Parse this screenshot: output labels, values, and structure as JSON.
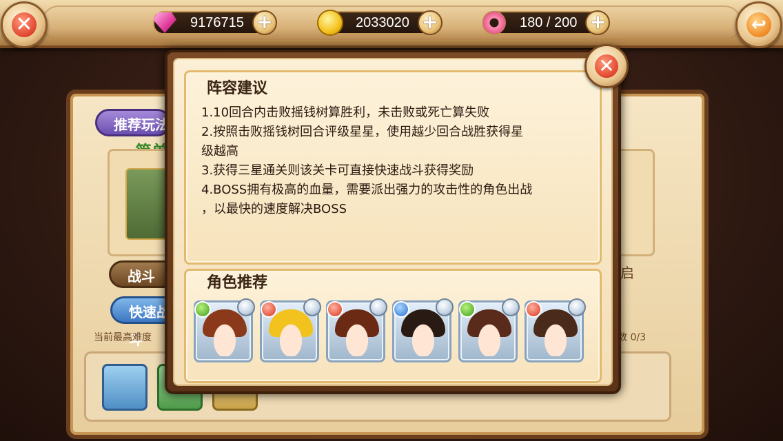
{
  "resources": {
    "gems": "9176715",
    "gold": "2033020",
    "stamina": "180 / 200"
  },
  "icons": {
    "top_left": "close-icon",
    "top_right": "back-arrow-icon",
    "gem": "pink-gem-icon",
    "gold": "gold-coin-icon",
    "stamina": "donut-icon",
    "plus": "plus-icon"
  },
  "background": {
    "tab_recommend": "推荐玩法",
    "difficulty": "简单",
    "battle_button": "战斗",
    "quick_battle_button": "快速战斗",
    "max_difficulty_note": "当前最高难度",
    "right_label": "启",
    "right_count": "数 0/3"
  },
  "modal": {
    "advice_title": "阵容建议",
    "advice_lines": [
      "1.10回合内击败摇钱树算胜利，未击败或死亡算失败",
      "2.按照击败摇钱树回合评级星星，使用越少回合战胜获得星",
      "级越高",
      "3.获得三星通关则该关卡可直接快速战斗获得奖励",
      "4.BOSS拥有极高的血量，需要派出强力的攻击性的角色出战",
      "，以最快的速度解决BOSS"
    ],
    "roles_title": "角色推荐",
    "heroes": [
      {
        "element": "wood",
        "hair": "#8a3a1a"
      },
      {
        "element": "fire",
        "hair": "#f2c21e"
      },
      {
        "element": "fire",
        "hair": "#6a2a14"
      },
      {
        "element": "water",
        "hair": "#2a1a14"
      },
      {
        "element": "wood",
        "hair": "#5a2a1a"
      },
      {
        "element": "fire",
        "hair": "#4a2a1a"
      }
    ]
  },
  "colors": {
    "panel_border": "#6b3f1e",
    "parchment": "#fbefd6",
    "accent_gold": "#e2b96f"
  }
}
